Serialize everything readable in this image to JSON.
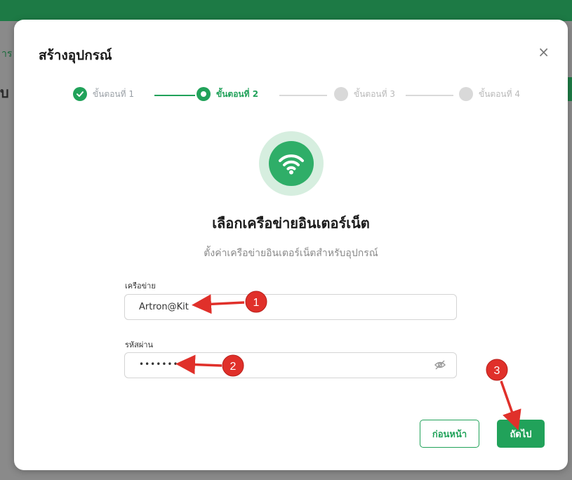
{
  "background": {
    "fragment_left": "าร",
    "fragment_heading": "บ"
  },
  "modal": {
    "title": "สร้างอุปกรณ์",
    "close_symbol": "×"
  },
  "stepper": {
    "steps": [
      {
        "label": "ขั้นตอนที่ 1",
        "state": "done"
      },
      {
        "label": "ขั้นตอนที่ 2",
        "state": "active"
      },
      {
        "label": "ขั้นตอนที่ 3",
        "state": "todo"
      },
      {
        "label": "ขั้นตอนที่ 4",
        "state": "todo"
      }
    ]
  },
  "content": {
    "icon": "wifi-icon",
    "title": "เลือกเครือข่ายอินเตอร์เน็ต",
    "subtitle": "ตั้งค่าเครือข่ายอินเตอร์เน็ตสำหรับอุปกรณ์"
  },
  "form": {
    "network": {
      "label": "เครือข่าย",
      "value": "Artron@Kit"
    },
    "password": {
      "label": "รหัสผ่าน",
      "value": "••••••••••",
      "toggle_icon": "eye-slash-icon"
    }
  },
  "buttons": {
    "prev": "ก่อนหน้า",
    "next": "ถัดไป"
  },
  "annotations": {
    "markers": [
      "1",
      "2",
      "3"
    ]
  },
  "colors": {
    "accent": "#21a25a",
    "annotation": "#e0302a",
    "top_bar": "#1d7a45"
  }
}
